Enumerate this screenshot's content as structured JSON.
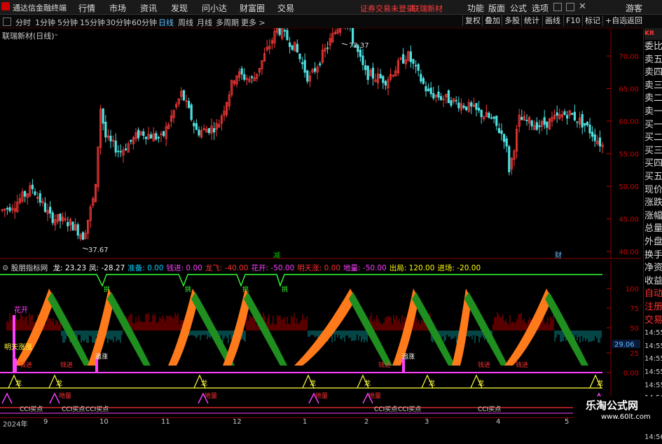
{
  "app": {
    "title": "通达信金融终端"
  },
  "menu": [
    "行情",
    "市场",
    "资讯",
    "发现",
    "问小达",
    "财富圈",
    "交易"
  ],
  "status_red": [
    "证券交易未登录",
    "联瑞新材"
  ],
  "right_menu": [
    "功能",
    "版面",
    "公式",
    "选项",
    "游客"
  ],
  "periods": [
    "分时",
    "1分钟",
    "5分钟",
    "15分钟",
    "30分钟",
    "60分钟",
    "日线",
    "周线",
    "月线",
    "多周期",
    "更多 >"
  ],
  "active_period": "日线",
  "tools": [
    "复权",
    "叠加",
    "多股",
    "统计",
    "画线",
    "F10",
    "标记",
    "+自选",
    "返回"
  ],
  "stock_title": "联瑞新材(日线)",
  "price_axis": [
    "70.00",
    "65.00",
    "60.00",
    "55.00",
    "50.00",
    "45.00",
    "40.00"
  ],
  "high_label": "72.37",
  "low_label": "37.67",
  "event_marks": [
    "减",
    "财"
  ],
  "indicator": {
    "name": "股朋指标网",
    "fields": [
      {
        "label": "龙: 23.23",
        "color": "#ffffff"
      },
      {
        "label": "凤: -28.27",
        "color": "#ffffff"
      },
      {
        "label": "准备: 0.00",
        "color": "#00d0ff"
      },
      {
        "label": "钱进: 0.00",
        "color": "#ff40ff"
      },
      {
        "label": "龙飞: -40.00",
        "color": "#ff3030"
      },
      {
        "label": "花开: -50.00",
        "color": "#ff40ff"
      },
      {
        "label": "明天涨: 0.00",
        "color": "#ff3030"
      },
      {
        "label": "地量: -50.00",
        "color": "#ff40ff"
      },
      {
        "label": "出局: 120.00",
        "color": "#ffff00"
      },
      {
        "label": "进场: -20.00",
        "color": "#ffff00"
      }
    ],
    "axis": [
      "100",
      "75",
      "50",
      "25",
      "0.00"
    ],
    "current_value": "29.06",
    "labels": {
      "kaihua": "花开",
      "mingtian": "明天涨涨",
      "qianjin": "钱进",
      "zhuizhang": "追涨",
      "long": "龙",
      "diliang": "地量",
      "cci": "CCI买点",
      "tiao": "挑"
    }
  },
  "dates": [
    "2024年",
    "9",
    "10",
    "11",
    "12",
    "1",
    "2",
    "3",
    "4",
    "5"
  ],
  "side_items": [
    "委比",
    "卖五",
    "卖四",
    "卖三",
    "卖二",
    "卖一",
    "买一",
    "买二",
    "买三",
    "买四",
    "买五",
    "现价",
    "涨跌",
    "涨幅",
    "总量",
    "外盘",
    "换手",
    "净资",
    "收益",
    "自动",
    "注册",
    "交易",
    "14:55",
    "14:55",
    "14:55",
    "14:55",
    "14:55",
    "14:56",
    "14:56",
    "14:56",
    "14:56"
  ],
  "watermark": {
    "title": "乐淘公式网",
    "url": "www.60lt.com"
  }
}
